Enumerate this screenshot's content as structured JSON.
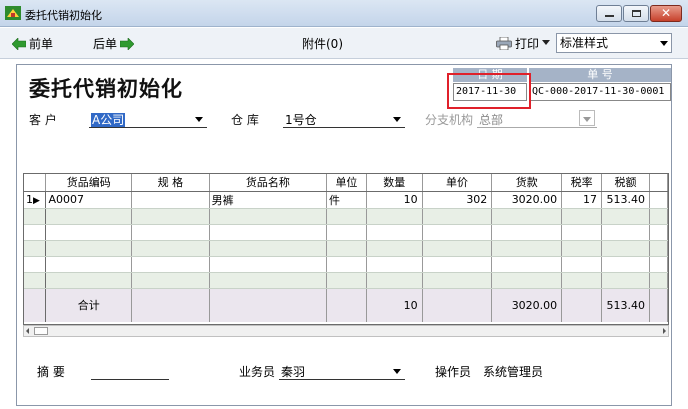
{
  "window": {
    "title": "委托代销初始化"
  },
  "toolbar": {
    "prev_label": "前单",
    "next_label": "后单",
    "attach_label": "附件(0)",
    "print_label": "打印",
    "style_value": "标准样式"
  },
  "form": {
    "title": "委托代销初始化",
    "date_label": "日 期",
    "date_value": "2017-11-30",
    "num_label": "单 号",
    "num_value": "QC-000-2017-11-30-0001",
    "customer_label": "客  户",
    "customer_value": "A公司",
    "warehouse_label": "仓  库",
    "warehouse_value": "1号仓",
    "branch_label": "分支机构",
    "branch_value": "总部"
  },
  "grid": {
    "columns": [
      "货品编码",
      "规  格",
      "货品名称",
      "单位",
      "数量",
      "单价",
      "货款",
      "税率",
      "税额"
    ],
    "rows": [
      {
        "index": "1",
        "marker": "▶",
        "code": "A0007",
        "spec": "",
        "name": "男裤",
        "unit": "件",
        "qty": "10",
        "price": "302",
        "amount": "3020.00",
        "tax_rate": "17",
        "tax": "513.40"
      }
    ],
    "summary": {
      "label": "合计",
      "qty": "10",
      "amount": "3020.00",
      "tax": "513.40"
    }
  },
  "footer": {
    "summary_label": "摘  要",
    "summary_value": "",
    "salesperson_label": "业务员",
    "salesperson_value": "秦羽",
    "operator_label": "操作员",
    "operator_value": "系统管理员"
  },
  "colors": {
    "highlight": "#e0202a",
    "selection": "#3169c6",
    "row_alt": "#e8efe6",
    "sum_row": "#ebe6ee"
  },
  "icons": {
    "prev": "green-left-arrow-icon",
    "next": "green-right-arrow-icon",
    "print": "printer-icon",
    "app": "app-icon"
  }
}
